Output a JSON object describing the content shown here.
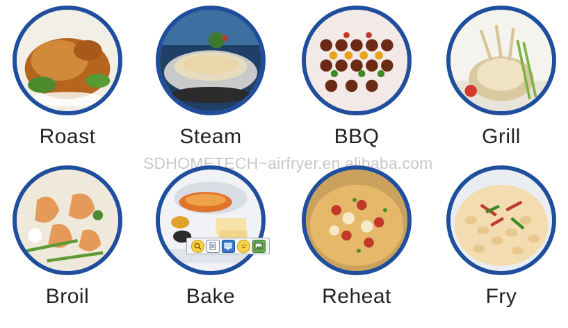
{
  "items": [
    {
      "label": "Roast"
    },
    {
      "label": "Steam"
    },
    {
      "label": "BBQ"
    },
    {
      "label": "Grill"
    },
    {
      "label": "Broil"
    },
    {
      "label": "Bake"
    },
    {
      "label": "Reheat"
    },
    {
      "label": "Fry"
    }
  ],
  "watermark": "SDHOMETECH~airfryer.en.alibaba.com",
  "colors": {
    "ring": "#1f4e9c",
    "label_text": "#222222",
    "watermark": "#c8c8c8"
  },
  "toolbar": {
    "icons": [
      "zoom-icon",
      "document-icon",
      "monitor-icon",
      "smile-icon",
      "image-icon"
    ]
  }
}
